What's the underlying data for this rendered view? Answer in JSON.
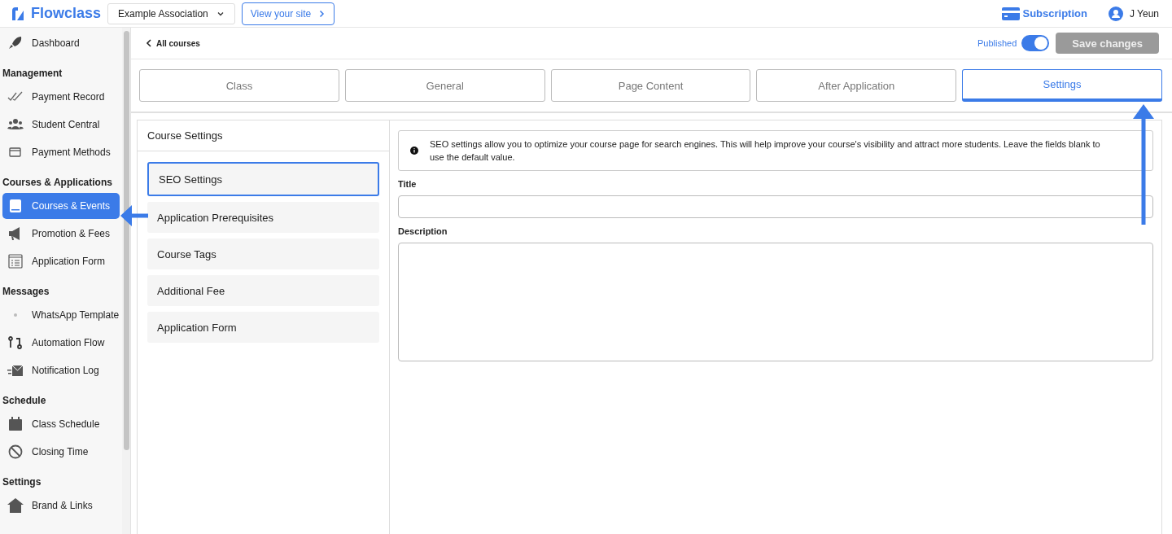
{
  "topbar": {
    "brand": "Flowclass",
    "organization": "Example Association",
    "view_site": "View your site",
    "subscription": "Subscription",
    "user": "J Yeun"
  },
  "sidebar": {
    "sections": [
      {
        "items": [
          {
            "label": "Dashboard",
            "selected": false
          }
        ]
      },
      {
        "heading": "Management",
        "items": [
          {
            "label": "Payment Record",
            "selected": false
          },
          {
            "label": "Student Central",
            "selected": false
          },
          {
            "label": "Payment Methods",
            "selected": false
          }
        ]
      },
      {
        "heading": "Courses & Applications",
        "items": [
          {
            "label": "Courses & Events",
            "selected": true
          },
          {
            "label": "Promotion & Fees",
            "selected": false
          },
          {
            "label": "Application Form",
            "selected": false
          }
        ]
      },
      {
        "heading": "Messages",
        "items": [
          {
            "label": "WhatsApp Template",
            "selected": false
          },
          {
            "label": "Automation Flow",
            "selected": false
          },
          {
            "label": "Notification Log",
            "selected": false
          }
        ]
      },
      {
        "heading": "Schedule",
        "items": [
          {
            "label": "Class Schedule",
            "selected": false
          },
          {
            "label": "Closing Time",
            "selected": false
          }
        ]
      },
      {
        "heading": "Settings",
        "items": [
          {
            "label": "Brand & Links",
            "selected": false
          }
        ]
      }
    ]
  },
  "header": {
    "back": "All courses",
    "published_label": "Published",
    "published": true,
    "save": {
      "label": "Save changes",
      "disabled": true
    }
  },
  "tabs": [
    {
      "label": "Class",
      "selected": false
    },
    {
      "label": "General",
      "selected": false
    },
    {
      "label": "Page Content",
      "selected": false
    },
    {
      "label": "After Application",
      "selected": false
    },
    {
      "label": "Settings",
      "selected": true
    }
  ],
  "course_settings": {
    "title": "Course Settings",
    "items": [
      {
        "label": "SEO Settings",
        "selected": true
      },
      {
        "label": "Application Prerequisites",
        "selected": false
      },
      {
        "label": "Course Tags",
        "selected": false
      },
      {
        "label": "Additional Fee",
        "selected": false
      },
      {
        "label": "Application Form",
        "selected": false
      }
    ]
  },
  "seo": {
    "info": "SEO settings allow you to optimize your course page for search engines. This will help improve your course's visibility and attract more students. Leave the fields blank to use the default value.",
    "fields": [
      {
        "label": "Title",
        "kind": "input"
      },
      {
        "label": "Description",
        "kind": "textarea"
      }
    ]
  }
}
